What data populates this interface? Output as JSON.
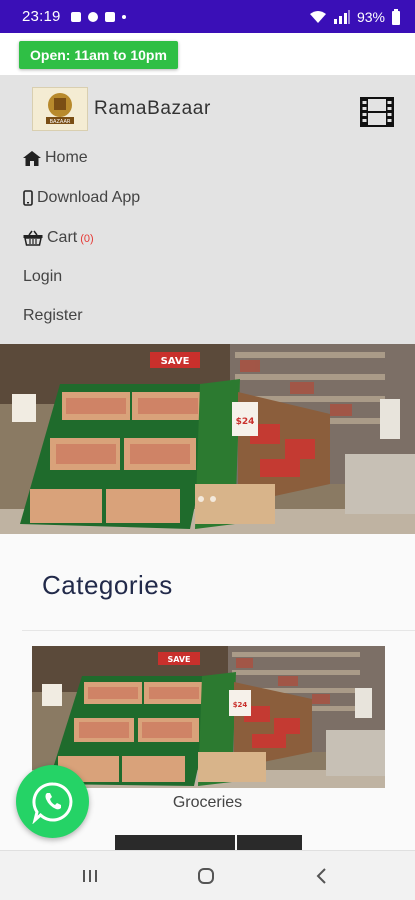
{
  "status_bar": {
    "time": "23:19",
    "battery": "93%",
    "notification_icons": [
      "photo-notification-icon",
      "lock-notification-icon",
      "gallery-notification-icon",
      "dot-notification-icon"
    ]
  },
  "hours": {
    "label": "Open: 11am to 10pm"
  },
  "brand": {
    "name": "RamaBazaar",
    "logo_text": "BAZAAR"
  },
  "nav": {
    "items": [
      {
        "label": "Home",
        "icon": "home-icon"
      },
      {
        "label": "Download App",
        "icon": "mobile-icon"
      },
      {
        "label": "Cart",
        "icon": "basket-icon",
        "count": "(0)"
      },
      {
        "label": "Login"
      },
      {
        "label": "Register"
      }
    ]
  },
  "hero": {
    "sign_text": "SAVE",
    "price_text": "$24"
  },
  "categories": {
    "title": "Categories",
    "items": [
      {
        "label": "Groceries",
        "sign_text": "SAVE",
        "price_text": "$24"
      }
    ]
  },
  "colors": {
    "status_bar": "#3a0fb7",
    "open_badge": "#2fbf45",
    "nav_background": "#e3e3e3",
    "category_title": "#222a4a",
    "whatsapp": "#25d366",
    "cart_count": "#e53935"
  }
}
